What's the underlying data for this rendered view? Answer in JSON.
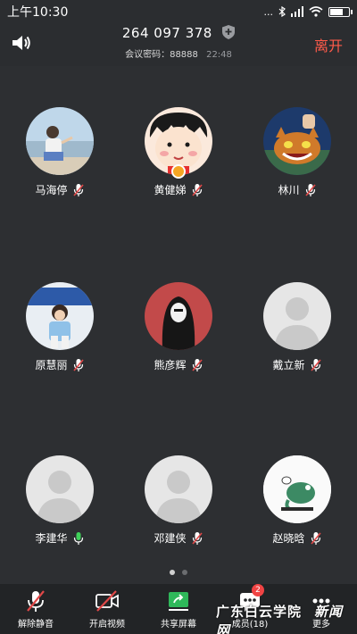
{
  "status_bar": {
    "time": "上午10:30",
    "signal": "...",
    "battery_fraction": 0.75
  },
  "header": {
    "meeting_id": "264 097 378",
    "password_label": "会议密码：88888",
    "elapsed": "22:48",
    "leave_label": "离开"
  },
  "participants": [
    {
      "name": "马海停",
      "mic": "muted"
    },
    {
      "name": "黄健娣",
      "mic": "muted",
      "host": true
    },
    {
      "name": "林川",
      "mic": "muted"
    },
    {
      "name": "原慧丽",
      "mic": "muted"
    },
    {
      "name": "熊彦辉",
      "mic": "muted"
    },
    {
      "name": "戴立新",
      "mic": "muted"
    },
    {
      "name": "李建华",
      "mic": "active"
    },
    {
      "name": "邓建侠",
      "mic": "muted"
    },
    {
      "name": "赵晓晗",
      "mic": "muted"
    }
  ],
  "pagination": {
    "pages": 2,
    "current": 1
  },
  "toolbar": {
    "unmute": "解除静音",
    "video": "开启视频",
    "share": "共享屏幕",
    "members": "成员(18)",
    "members_badge": "2",
    "more": "更多"
  },
  "watermark": {
    "text": "广东白云学院",
    "site": "新闻网"
  },
  "colors": {
    "leave": "#ff5b4a",
    "muted_mic": "#e04848",
    "active_mic": "#3fd25a",
    "share": "#2fb85a"
  }
}
